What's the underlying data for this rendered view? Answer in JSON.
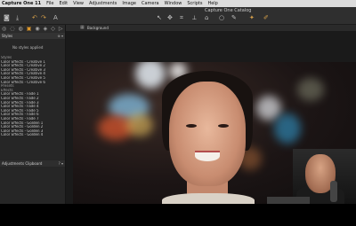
{
  "menubar": {
    "app_name": "Capture One 11",
    "items": [
      "File",
      "Edit",
      "View",
      "Adjustments",
      "Image",
      "Camera",
      "Window",
      "Scripts",
      "Help"
    ]
  },
  "window": {
    "title": "Capture One Catalog"
  },
  "toolbar_icons": {
    "left": [
      "camera-capture-icon",
      "import-icon",
      "undo-icon",
      "redo-icon",
      "text-icon"
    ],
    "right": [
      "cursor-icon",
      "pan-icon",
      "crop-icon",
      "straighten-icon",
      "keystone-icon",
      "spot-icon",
      "mask-icon",
      "color-picker-icon",
      "white-balance-icon"
    ]
  },
  "tool_tabs": [
    "◎",
    "◌",
    "◍",
    "▣",
    "◉",
    "◈",
    "◇",
    "▷"
  ],
  "styles_panel": {
    "header": "Styles",
    "controls": "⊕ ▾",
    "empty_message": "No styles applied",
    "items": [
      {
        "label": "Styles",
        "group": true
      },
      {
        "label": "Color Effects - Creative 1",
        "group": false
      },
      {
        "label": "Color Effects - Creative 2",
        "group": false
      },
      {
        "label": "Color Effects - Creative 3",
        "group": false
      },
      {
        "label": "Color Effects - Creative 4",
        "group": false
      },
      {
        "label": "Color Effects - Creative 5",
        "group": false
      },
      {
        "label": "Color Effects - Creative 6",
        "group": false
      },
      {
        "label": "Presets",
        "group": true
      },
      {
        "label": "Effects",
        "group": true
      },
      {
        "label": "Color Effects - Fade 1",
        "group": false
      },
      {
        "label": "Color Effects - Fade 2",
        "group": false
      },
      {
        "label": "Color Effects - Fade 3",
        "group": false
      },
      {
        "label": "Color Effects - Fade 4",
        "group": false
      },
      {
        "label": "Color Effects - Fade 5",
        "group": false
      },
      {
        "label": "Color Effects - Fade 6",
        "group": false
      },
      {
        "label": "Color Effects - Fade 7",
        "group": false
      },
      {
        "label": "Color Effects - Golden 1",
        "group": false
      },
      {
        "label": "Color Effects - Golden 2",
        "group": false
      },
      {
        "label": "Color Effects - Golden 3",
        "group": false
      },
      {
        "label": "Color Effects - Golden 4",
        "group": false
      }
    ]
  },
  "clipboard_panel": {
    "header": "Adjustments Clipboard",
    "controls": "? ▾"
  },
  "viewer": {
    "label": "Background"
  }
}
